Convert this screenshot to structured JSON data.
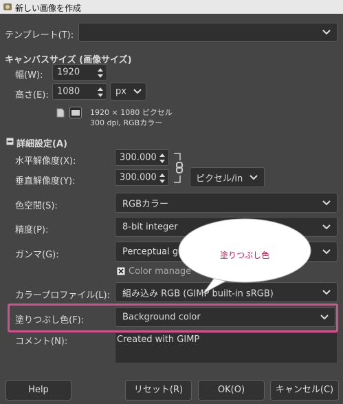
{
  "window": {
    "title": "新しい画像を作成"
  },
  "template": {
    "label": "テンプレート(T):",
    "value": ""
  },
  "canvas_size": {
    "heading": "キャンバスサイズ (画像サイズ)",
    "width_label": "幅(W):",
    "width_value": "1920",
    "height_label": "高さ(E):",
    "height_value": "1080",
    "unit": "px",
    "info_line1": "1920 × 1080 ピクセル",
    "info_line2": "300 dpi, RGBカラー"
  },
  "advanced": {
    "heading": "詳細設定(A)",
    "xres_label": "水平解像度(X):",
    "xres_value": "300.000",
    "yres_label": "垂直解像度(Y):",
    "yres_value": "300.000",
    "res_unit": "ピクセル/in",
    "colorspace_label": "色空間(S):",
    "colorspace_value": "RGBカラー",
    "precision_label": "精度(P):",
    "precision_value": "8-bit integer",
    "gamma_label": "ガンマ(G):",
    "gamma_value": "Perceptual ga",
    "color_manage_label": "Color manage",
    "color_manage_checked": true,
    "profile_label": "カラープロファイル(L):",
    "profile_value": "組み込み RGB (GIMP built-in sRGB)",
    "fill_label": "塗りつぶし色(F):",
    "fill_value": "Background color",
    "comment_label": "コメント(N):",
    "comment_value": "Created with GIMP"
  },
  "callout": {
    "text": "塗りつぶし色",
    "color": "#c2185b",
    "highlight_color": "#d4508a"
  },
  "buttons": {
    "help": "Help",
    "reset": "リセット(R)",
    "ok": "OK(O)",
    "cancel": "キャンセル(C)"
  }
}
